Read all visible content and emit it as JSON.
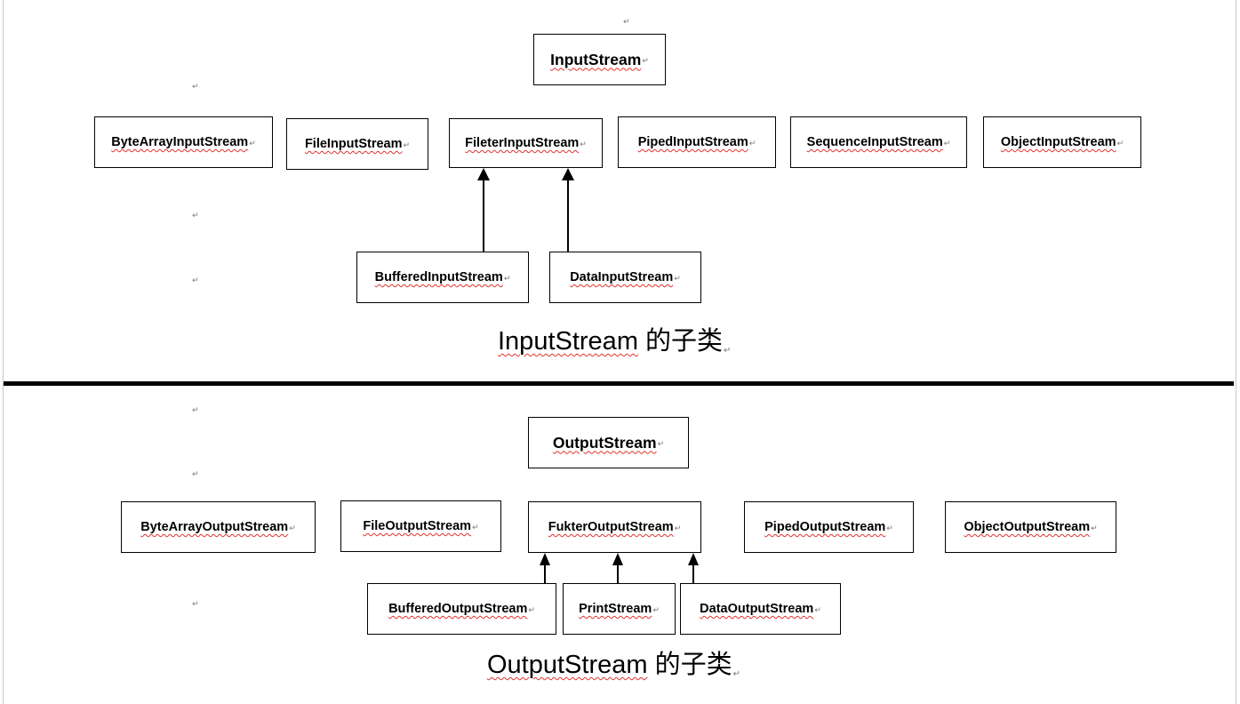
{
  "paragraph_mark": "↵",
  "input_section": {
    "root": "InputStream",
    "subclasses": [
      "ByteArrayInputStream",
      "FileInputStream",
      "FileterInputStream",
      "PipedInputStream",
      "SequenceInputStream",
      "ObjectInputStream"
    ],
    "filter_subclasses": [
      "BufferedInputStream",
      "DataInputStream"
    ],
    "caption_word": "InputStream",
    "caption_suffix": " 的子类"
  },
  "output_section": {
    "root": "OutputStream",
    "subclasses": [
      "ByteArrayOutputStream",
      "FileOutputStream",
      "FukterOutputStream",
      "PipedOutputStream",
      "ObjectOutputStream"
    ],
    "filter_subclasses": [
      "BufferedOutputStream",
      "PrintStream",
      "DataOutputStream"
    ],
    "caption_word": "OutputStream",
    "caption_suffix": " 的子类"
  },
  "colors": {
    "box_border": "#000000",
    "spellcheck_underline": "#e0322d",
    "divider": "#000000",
    "paragraph_mark": "#777777"
  }
}
